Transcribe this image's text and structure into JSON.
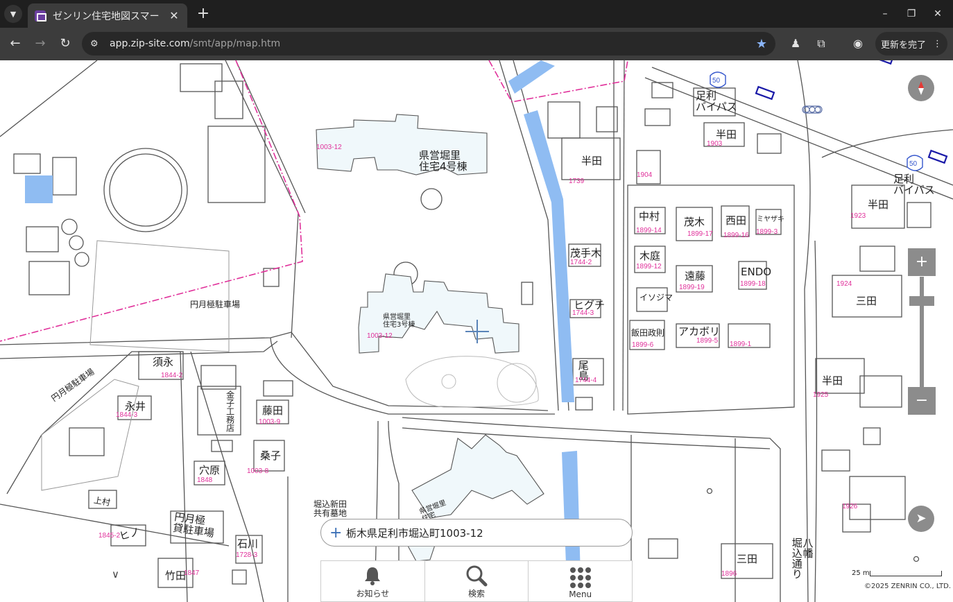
{
  "browser": {
    "tab_title": "ゼンリン住宅地図スマー",
    "url_host": "app.zip-site.com",
    "url_path": "/smt/app/map.htm",
    "update_label": "更新を完了"
  },
  "map": {
    "building_labels": [
      "県営堀里\n住宅4号棟",
      "半田",
      "中村",
      "茂木",
      "西田",
      "ミヤザキ",
      "茂手木",
      "木庭",
      "遠藤",
      "ENDO",
      "イソジマ",
      "ヒグチ",
      "飯田政則",
      "アカボリ",
      "尾島",
      "半田",
      "三田",
      "半田",
      "半田",
      "三田",
      "須永",
      "永井",
      "金子工務店",
      "藤田",
      "桑子",
      "穴原",
      "上村",
      "ヒノ",
      "石川",
      "竹田",
      "円月極\n貸駐車場"
    ],
    "road_labels": [
      "足利\nバイパス",
      "足利\nバイパス",
      "八幡\n堀込通り"
    ],
    "parking_labels": [
      "円月極駐車場",
      "円月極駐車場"
    ],
    "other_labels": [
      "県営堀里\n住宅3号棟",
      "堀込新田\n共有墓地",
      "県営堀里\n住宅"
    ],
    "route_numbers": [
      "50",
      "50"
    ],
    "lot_numbers": [
      "1003-12",
      "1003-12",
      "1739",
      "1904",
      "1903",
      "1899-14",
      "1899-17",
      "1899-16",
      "1899-3",
      "1744-2",
      "1899-12",
      "1899-19",
      "1899-18",
      "1744-3",
      "1899-6",
      "1899-5",
      "1899-1",
      "1744-4",
      "1923",
      "1924",
      "1925",
      "1926",
      "1896",
      "1844-2",
      "1844-3",
      "1003-9",
      "1003-8",
      "1848",
      "1845-2",
      "1728-3",
      "1847"
    ],
    "address": "栃木県足利市堀込町1003-12",
    "scale_label": "25 m",
    "copyright": "©2025 ZENRIN CO., LTD."
  },
  "menu": {
    "items": [
      {
        "label": "お知らせ",
        "icon": "bell-icon"
      },
      {
        "label": "検索",
        "icon": "search-icon"
      },
      {
        "label": "Menu",
        "icon": "grid-menu-icon"
      }
    ]
  },
  "colors": {
    "building_fill": "#f0f8fb",
    "water": "#8fbcf2",
    "boundary": "#e0309a",
    "lot_number": "#e0309a",
    "controls": "#8c8c8c"
  }
}
